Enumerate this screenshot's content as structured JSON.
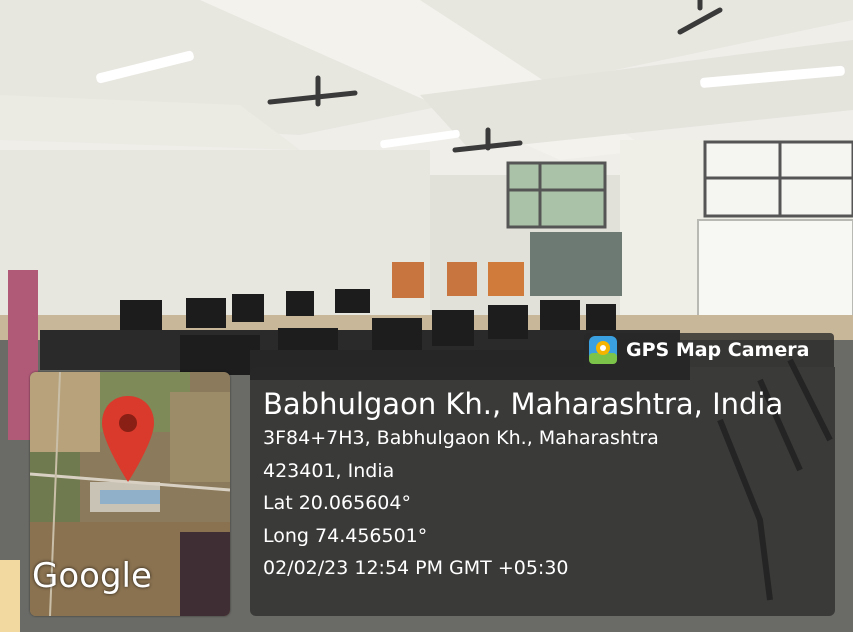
{
  "overlay": {
    "brand": "GPS Map Camera",
    "brand_icon": "map-pin-camera-icon",
    "map_watermark": "Google",
    "location_title": "Babhulgaon Kh., Maharashtra, India",
    "address_line1": "3F84+7H3, Babhulgaon Kh., Maharashtra",
    "address_line2": "423401, India",
    "latitude": "Lat 20.065604°",
    "longitude": "Long 74.456501°",
    "datetime": "02/02/23 12:54 PM GMT +05:30"
  },
  "colors": {
    "panel": "#282828",
    "pin": "#d93a2b",
    "ceiling": "#efeee8",
    "wall": "#e6e4dc"
  }
}
